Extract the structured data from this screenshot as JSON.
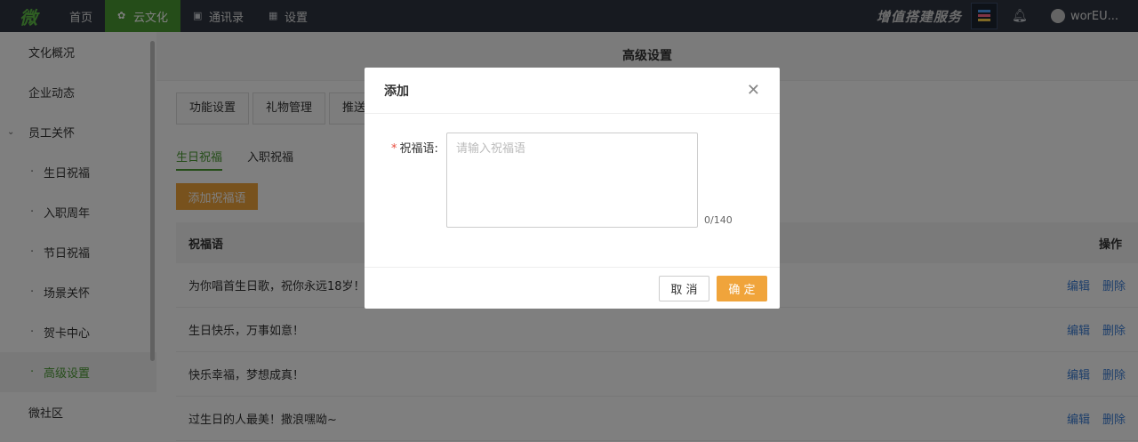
{
  "topnav": {
    "logo": "微",
    "items": [
      {
        "label": "首页"
      },
      {
        "label": "云文化"
      },
      {
        "label": "通讯录"
      },
      {
        "label": "设置"
      }
    ],
    "promo_text": "增值搭建服务",
    "user_name": "worEU..."
  },
  "sidebar": {
    "items": [
      {
        "label": "文化概况"
      },
      {
        "label": "企业动态"
      },
      {
        "label": "员工关怀"
      },
      {
        "label": "生日祝福"
      },
      {
        "label": "入职周年"
      },
      {
        "label": "节日祝福"
      },
      {
        "label": "场景关怀"
      },
      {
        "label": "贺卡中心"
      },
      {
        "label": "高级设置"
      },
      {
        "label": "微社区"
      }
    ]
  },
  "main": {
    "page_title": "高级设置",
    "tabs": [
      {
        "label": "功能设置"
      },
      {
        "label": "礼物管理"
      },
      {
        "label": "推送图"
      }
    ],
    "subtabs": [
      {
        "label": "生日祝福"
      },
      {
        "label": "入职祝福"
      }
    ],
    "add_button": "添加祝福语",
    "table": {
      "columns": [
        "祝福语",
        "操作"
      ],
      "rows": [
        {
          "text": "为你唱首生日歌，祝你永远18岁！",
          "edit": "编辑",
          "delete": "删除"
        },
        {
          "text": "生日快乐，万事如意！",
          "edit": "编辑",
          "delete": "删除"
        },
        {
          "text": "快乐幸福，梦想成真！",
          "edit": "编辑",
          "delete": "删除"
        },
        {
          "text": "过生日的人最美！撒浪嘿呦~",
          "edit": "编辑",
          "delete": "删除"
        }
      ]
    }
  },
  "modal": {
    "title": "添加",
    "field_label": "祝福语:",
    "required_mark": "*",
    "textarea_value": "",
    "textarea_placeholder": "请输入祝福语",
    "counter": "0/140",
    "cancel_label": "取 消",
    "ok_label": "确 定"
  },
  "colors": {
    "topbar_bg": "#2f3541",
    "accent_green": "#4a9b33",
    "accent_orange": "#f0a43b",
    "link_blue": "#3d7fd6"
  }
}
